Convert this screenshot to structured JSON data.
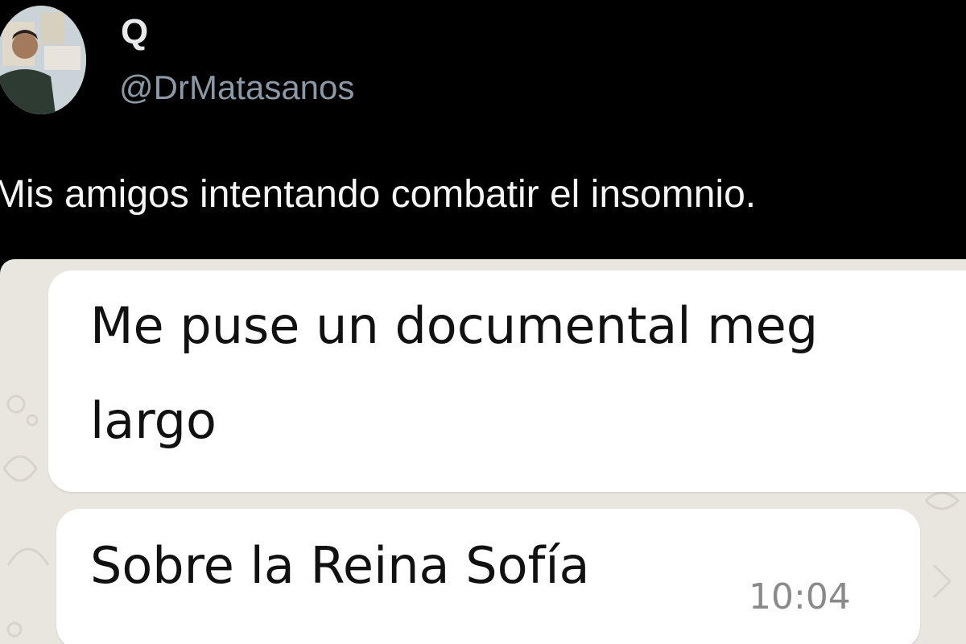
{
  "tweet": {
    "display_name": "Q",
    "handle": "@DrMatasanos",
    "text": "Mis amigos intentando combatir el insomnio.",
    "avatar_icon": "profile-photo"
  },
  "chat": {
    "background_color": "#e9e6e0",
    "bubble_color": "#ffffff",
    "messages": [
      {
        "text": "Me puse un documental meg\nlargo",
        "time": ""
      },
      {
        "text": "Sobre la Reina Sofía",
        "time": "10:04"
      }
    ]
  }
}
